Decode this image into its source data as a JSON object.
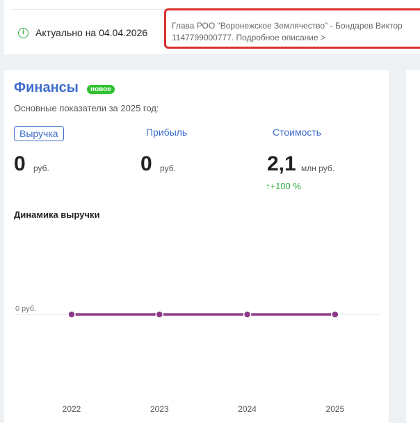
{
  "header": {
    "actual_label": "Актуально на 04.04.2026",
    "head_line": "Глава РОО \"Воронежское Землячество\" - Бондарев Виктор",
    "head_link": "1147799000777. Подробное описание >"
  },
  "finance": {
    "title": "Финансы",
    "badge": "новое",
    "subtitle": "Основные показатели за 2025 год:",
    "tabs": [
      {
        "label": "Выручка",
        "active": true
      },
      {
        "label": "Прибыль",
        "active": false
      },
      {
        "label": "Стоимость",
        "active": false
      }
    ],
    "metrics": [
      {
        "value": "0",
        "unit": "руб."
      },
      {
        "value": "0",
        "unit": "руб."
      },
      {
        "value": "2,1",
        "unit": "млн руб.",
        "change": "↑+100 %"
      }
    ],
    "chart_title": "Динамика выручки"
  },
  "colors": {
    "accent": "#3d6ccc",
    "badge": "#2ec22e",
    "positive": "#2eaa3c",
    "line": "#8e3b87",
    "highlight_border": "#d9302c"
  },
  "chart_data": {
    "type": "line",
    "title": "",
    "xlabel": "",
    "ylabel": "",
    "x": [
      "2022",
      "2023",
      "2024",
      "2025"
    ],
    "series": [
      {
        "values": [
          0,
          0,
          0,
          0
        ]
      }
    ],
    "y_tick_labels": [
      "0 руб."
    ],
    "grid": true
  }
}
